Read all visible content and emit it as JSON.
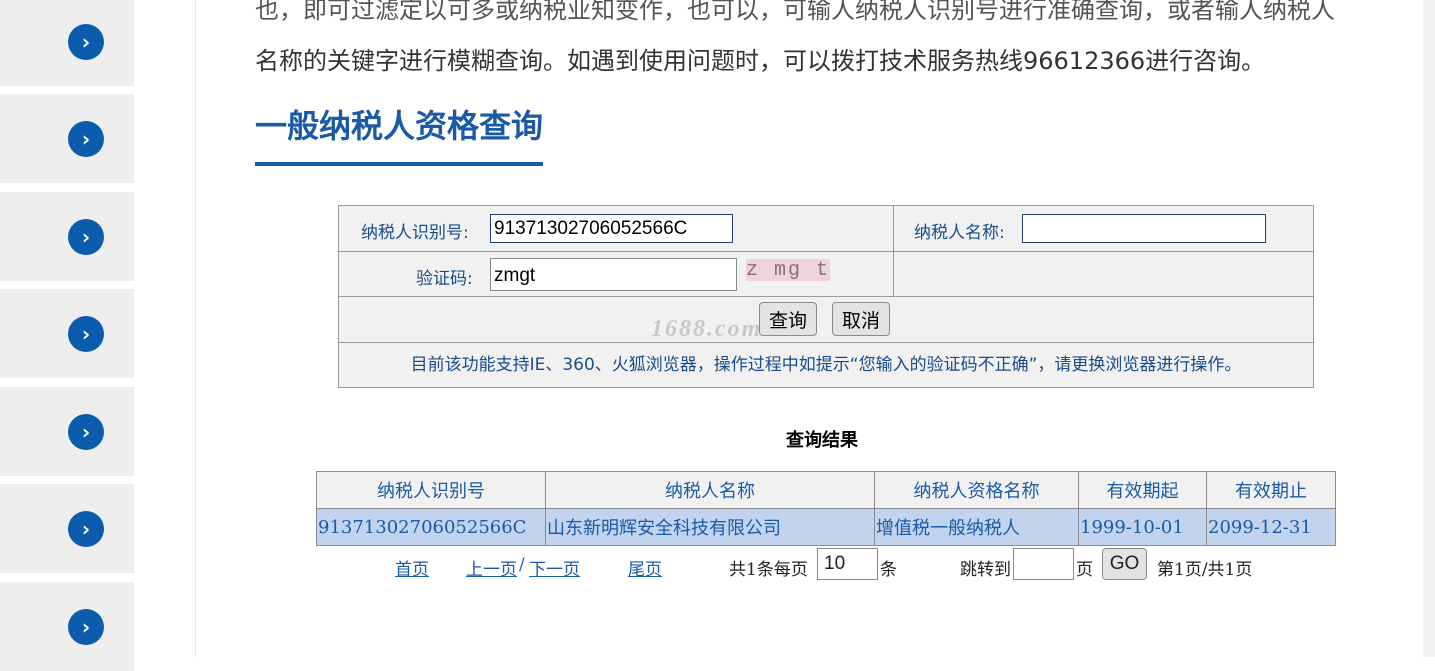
{
  "intro": {
    "line1": "也，即可过滤定以可多或纳税业知变作，也可以，可输人纳税人识别号进行准确查询，或者输人纳税人",
    "line2": "名称的关键字进行模糊查询。如遇到使用问题时，可以拨打技术服务热线96612366进行咨询。"
  },
  "heading": "一般纳税人资格查询",
  "form": {
    "taxpayer_id_label": "纳税人识别号:",
    "taxpayer_id_value": "91371302706052566C",
    "taxpayer_name_label": "纳税人名称:",
    "taxpayer_name_value": "",
    "captcha_label": "验证码:",
    "captcha_value": "zmgt",
    "captcha_image_text": "z mg t",
    "query_button": "查询",
    "cancel_button": "取消",
    "note": "目前该功能支持IE、360、火狐浏览器，操作过程中如提示“您输入的验证码不正确”，请更换浏览器进行操作。"
  },
  "watermark": "1688.com",
  "results": {
    "title": "查询结果",
    "columns": [
      "纳税人识别号",
      "纳税人名称",
      "纳税人资格名称",
      "有效期起",
      "有效期止"
    ],
    "rows": [
      [
        "91371302706052566C",
        "山东新明辉安全科技有限公司",
        "增值税一般纳税人",
        "1999-10-01",
        "2099-12-31"
      ]
    ]
  },
  "pager": {
    "first": "首页",
    "prev": "上一页",
    "separator": "/",
    "next": "下一页",
    "last": "尾页",
    "total_text": "共1条每页",
    "per_page": "10",
    "unit": "条",
    "jump_label": "跳转到",
    "jump_value": "",
    "page_unit": "页",
    "go_button": "GO",
    "status": "第1页/共1页"
  },
  "sidebar": {
    "arrow_icon": "chevron-right-icon",
    "tile_count": 7
  },
  "colors": {
    "accent": "#1a5aa6",
    "sidebar_button": "#0b5cad",
    "result_row": "#c2d3ee"
  }
}
